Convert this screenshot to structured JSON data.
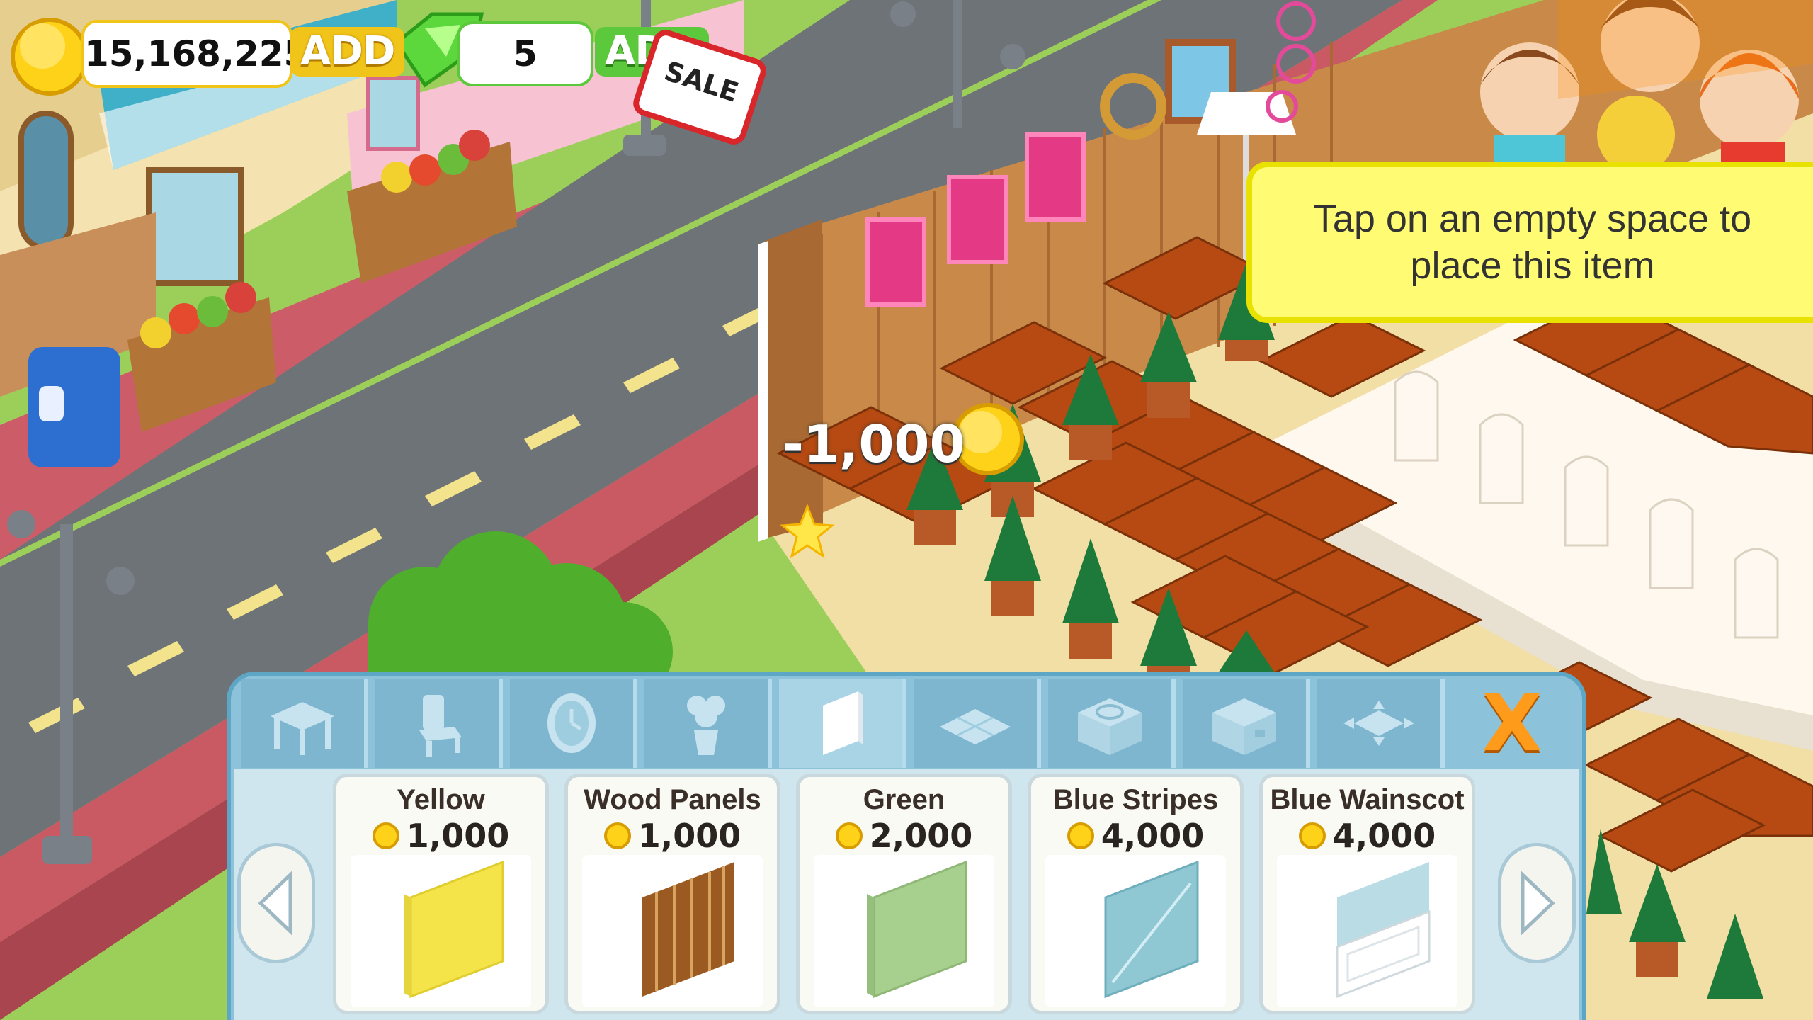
{
  "hud": {
    "coins": "15,168,225",
    "coins_add": "ADD",
    "gems": "5",
    "gems_add": "ADD",
    "sale_label": "SALE"
  },
  "tooltip": {
    "text": "Tap on an empty space to place this item"
  },
  "float_cost": "-1,000",
  "tabs": [
    {
      "name": "tab-tables",
      "icon": "table-icon",
      "active": false
    },
    {
      "name": "tab-chairs",
      "icon": "chair-icon",
      "active": false
    },
    {
      "name": "tab-clocks",
      "icon": "clock-icon",
      "active": false
    },
    {
      "name": "tab-plants",
      "icon": "plant-icon",
      "active": false
    },
    {
      "name": "tab-walls",
      "icon": "wall-panel-icon",
      "active": true
    },
    {
      "name": "tab-floors",
      "icon": "floor-tile-icon",
      "active": false
    },
    {
      "name": "tab-stoves",
      "icon": "stove-icon",
      "active": false
    },
    {
      "name": "tab-counters",
      "icon": "counter-icon",
      "active": false
    },
    {
      "name": "tab-expand",
      "icon": "expand-icon",
      "active": false
    }
  ],
  "close_label": "X",
  "items": [
    {
      "name": "Yellow",
      "price": "1,000",
      "color": "#f5e34a"
    },
    {
      "name": "Wood Panels",
      "price": "1,000",
      "color": "#9b5a22"
    },
    {
      "name": "Green",
      "price": "2,000",
      "color": "#a7cf8e"
    },
    {
      "name": "Blue Stripes",
      "price": "4,000",
      "color": "#8fc7d3"
    },
    {
      "name": "Blue Wainscot",
      "price": "4,000",
      "color": "#b9dce5"
    }
  ],
  "colors": {
    "coin": "#ffd21a",
    "gem": "#5cc83c",
    "road": "#6d7377",
    "sidewalk": "#c95a64",
    "grass": "#9ccf5a",
    "wall_wood": "#c98a49",
    "tooltip_bg": "#fffb73",
    "panel": "#8dc3da"
  }
}
